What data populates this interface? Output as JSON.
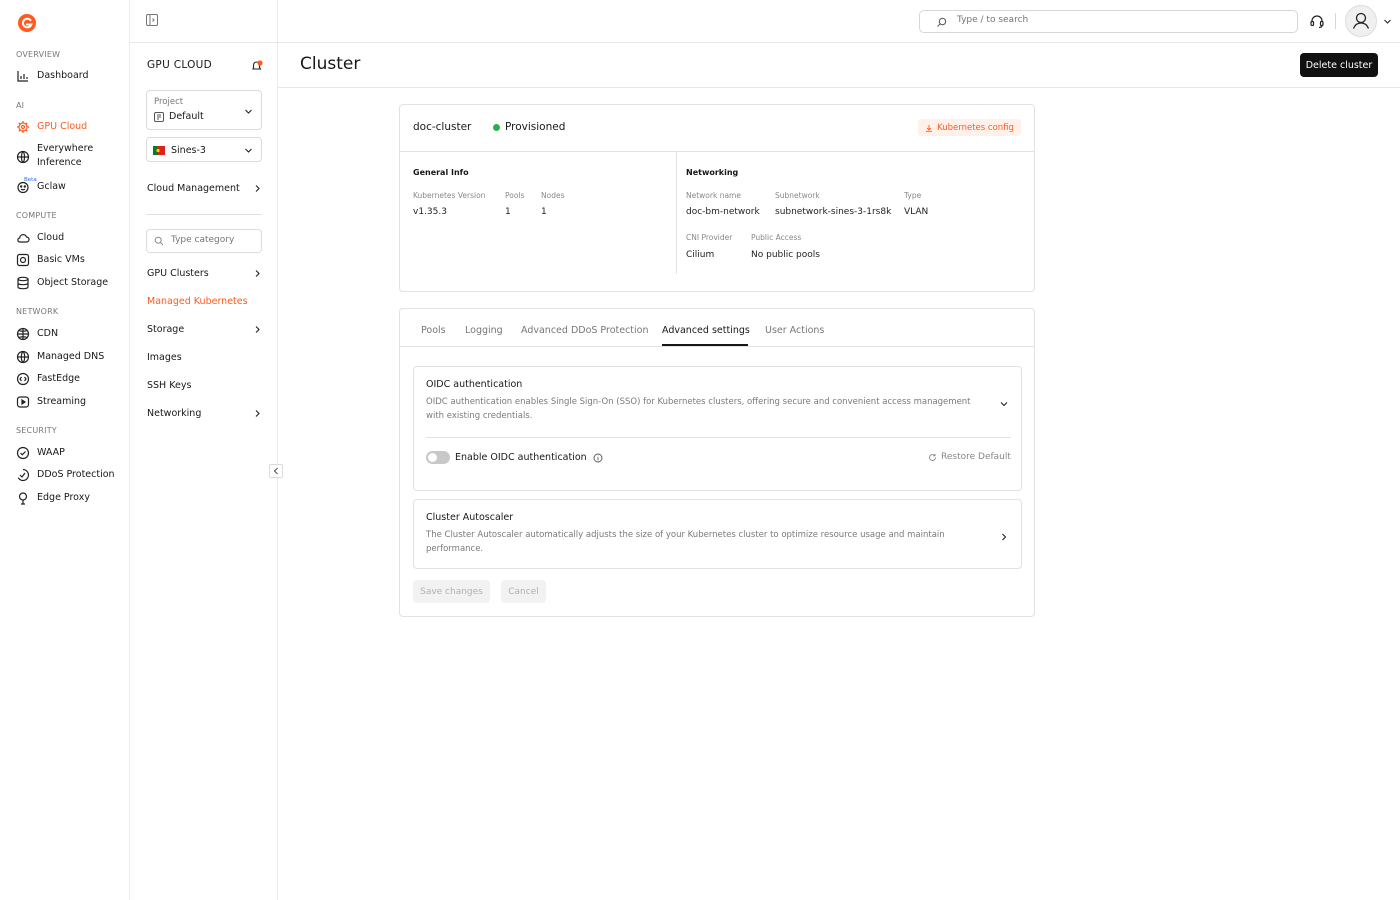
{
  "nav": {
    "sections": [
      {
        "id": "overview",
        "label": "OVERVIEW"
      },
      {
        "id": "ai",
        "label": "AI"
      },
      {
        "id": "compute",
        "label": "COMPUTE"
      },
      {
        "id": "network",
        "label": "NETWORK"
      },
      {
        "id": "security",
        "label": "SECURITY"
      }
    ],
    "items": {
      "dashboard": "Dashboard",
      "gpu_cloud": "GPU Cloud",
      "everywhere_inference": "Everywhere Inference",
      "gclaw": "Gclaw",
      "gclaw_badge": "Beta",
      "cloud": "Cloud",
      "basic_vms": "Basic VMs",
      "object_storage": "Object Storage",
      "cdn": "CDN",
      "managed_dns": "Managed DNS",
      "fastedge": "FastEdge",
      "streaming": "Streaming",
      "waap": "WAAP",
      "ddos_protection": "DDoS Protection",
      "edge_proxy": "Edge Proxy"
    },
    "accent_color": "#ff5a1f"
  },
  "subnav": {
    "title": "GPU CLOUD",
    "project_label": "Project",
    "project_value": "Default",
    "region_value": "Sines-3",
    "cloud_management": "Cloud Management",
    "category_placeholder": "Type category",
    "items": {
      "gpu_clusters": "GPU Clusters",
      "managed_kubernetes": "Managed Kubernetes",
      "storage": "Storage",
      "images": "Images",
      "ssh_keys": "SSH Keys",
      "networking": "Networking"
    }
  },
  "header": {
    "search_placeholder": "Type / to search"
  },
  "page": {
    "title": "Cluster",
    "delete_button": "Delete cluster"
  },
  "cluster": {
    "name": "doc-cluster",
    "status": "Provisioned",
    "status_color": "#27b14c",
    "kube_config_button": "Kubernetes config",
    "general": {
      "heading": "General Info",
      "k8s_version_label": "Kubernetes Version",
      "k8s_version": "v1.35.3",
      "pools_label": "Pools",
      "pools": "1",
      "nodes_label": "Nodes",
      "nodes": "1"
    },
    "networking": {
      "heading": "Networking",
      "network_name_label": "Network name",
      "network_name": "doc-bm-network",
      "subnetwork_label": "Subnetwork",
      "subnetwork": "subnetwork-sines-3-1rs8k",
      "type_label": "Type",
      "type": "VLAN",
      "cni_label": "CNI Provider",
      "cni": "Cilium",
      "public_access_label": "Public Access",
      "public_access": "No public pools"
    }
  },
  "tabs": {
    "pools": "Pools",
    "logging": "Logging",
    "ddos": "Advanced DDoS Protection",
    "advanced": "Advanced settings",
    "user_actions": "User Actions",
    "active": "advanced"
  },
  "advanced": {
    "oidc": {
      "title": "OIDC authentication",
      "description": "OIDC authentication enables Single Sign-On (SSO) for Kubernetes clusters, offering secure and convenient access management with existing credentials.",
      "toggle_label": "Enable OIDC authentication",
      "restore": "Restore Default"
    },
    "autoscaler": {
      "title": "Cluster Autoscaler",
      "description": "The Cluster Autoscaler automatically adjusts the size of your Kubernetes cluster to optimize resource usage and maintain performance."
    },
    "save_button": "Save changes",
    "cancel_button": "Cancel"
  }
}
